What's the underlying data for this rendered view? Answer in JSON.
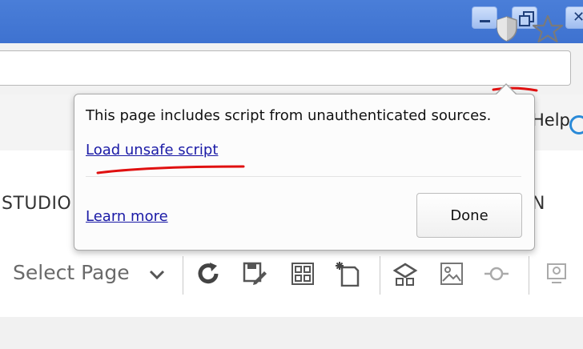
{
  "popup": {
    "message": "This page includes script from unauthenticated sources.",
    "load_link": "Load unsafe script",
    "learn_link": "Learn more",
    "done_label": "Done"
  },
  "menu": {
    "help_label": "Help"
  },
  "tabs": {
    "left_label": "STUDIO",
    "right_label": "N"
  },
  "toolbar": {
    "select_value": "Select Page"
  },
  "colors": {
    "titlebar": "#4a7ed8",
    "link": "#1a1aa6",
    "annotation": "#e01010"
  },
  "icons": [
    "minimize-icon",
    "maximize-icon",
    "close-icon",
    "shield-icon",
    "star-icon",
    "chevron-down-icon",
    "refresh-icon",
    "save-edit-icon",
    "grid-icon",
    "new-page-icon",
    "settings-icon",
    "image-icon",
    "link-icon",
    "monitor-icon"
  ]
}
